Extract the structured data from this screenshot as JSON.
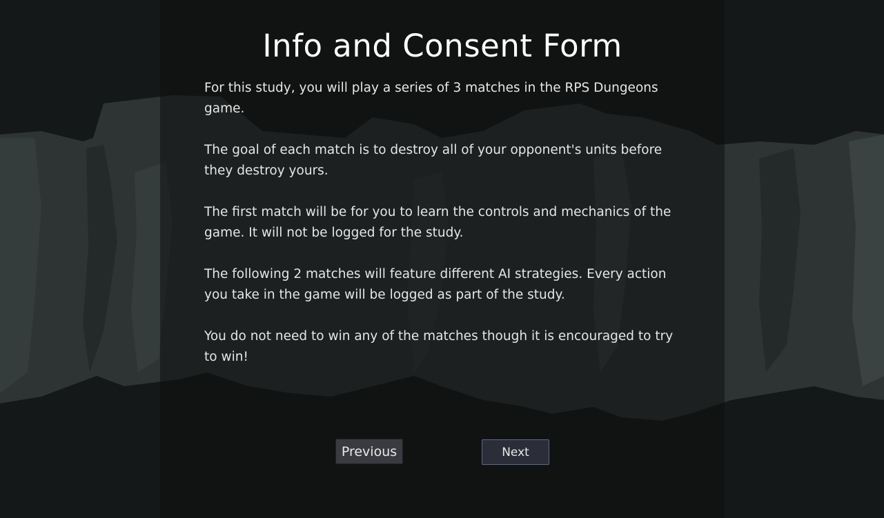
{
  "form": {
    "title": "Info and Consent Form",
    "paragraphs": [
      "For this study, you will play a series of 3 matches in the RPS Dungeons game.",
      "The goal of each match is to destroy all of your opponent's units before they destroy yours.",
      "The first match will be for you to learn the controls and mechanics of the game. It will not be logged for the study.",
      "The following 2 matches will feature different AI strategies. Every action you take in the game will be logged as part of the study.",
      "You do not need to win any of the matches though it is encouraged to try to win!"
    ]
  },
  "buttons": {
    "previous_label": "Previous",
    "next_label": "Next"
  },
  "colors": {
    "background": "#151818",
    "rock_silhouette": "#2f3535",
    "rock_shadow": "#262b2b",
    "panel_overlay": "#0e1010",
    "next_border": "#5d6a86"
  }
}
